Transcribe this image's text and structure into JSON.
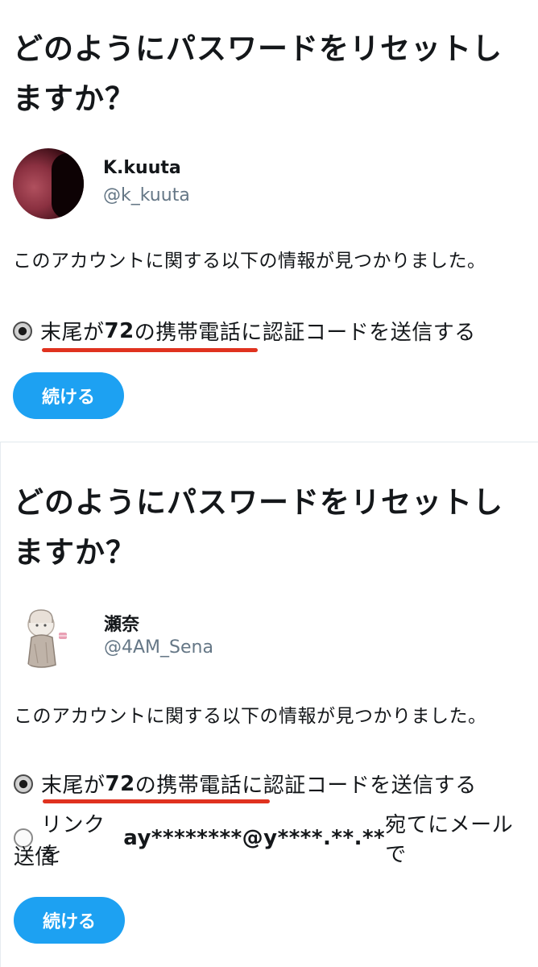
{
  "screens": [
    {
      "heading": "どのようにパスワードをリセットしますか？",
      "user": {
        "display_name": "K.kuuta",
        "handle": "@k_kuuta"
      },
      "info_text": "このアカウントに関する以下の情報が見つかりました。",
      "options": [
        {
          "selected": true,
          "text_before": "末尾が",
          "text_bold": "72",
          "text_after": "の携帯電話に認証コードを送信する"
        }
      ],
      "continue_label": "続ける"
    },
    {
      "heading": "どのようにパスワードをリセットしますか？",
      "user": {
        "display_name": "瀬奈",
        "handle": "@4AM_Sena"
      },
      "info_text": "このアカウントに関する以下の情報が見つかりました。",
      "options": [
        {
          "selected": true,
          "text_before": "末尾が",
          "text_bold": "72",
          "text_after": "の携帯電話に認証コードを送信する"
        },
        {
          "selected": false,
          "text_before": "リンクを",
          "text_bold": "ay********@y****.**.**",
          "text_after": "宛てにメールで",
          "text_wrap": "送信"
        }
      ],
      "continue_label": "続ける"
    }
  ],
  "colors": {
    "accent": "#1da1f2",
    "underline_annotation": "#e0321f",
    "handle": "#657786"
  }
}
